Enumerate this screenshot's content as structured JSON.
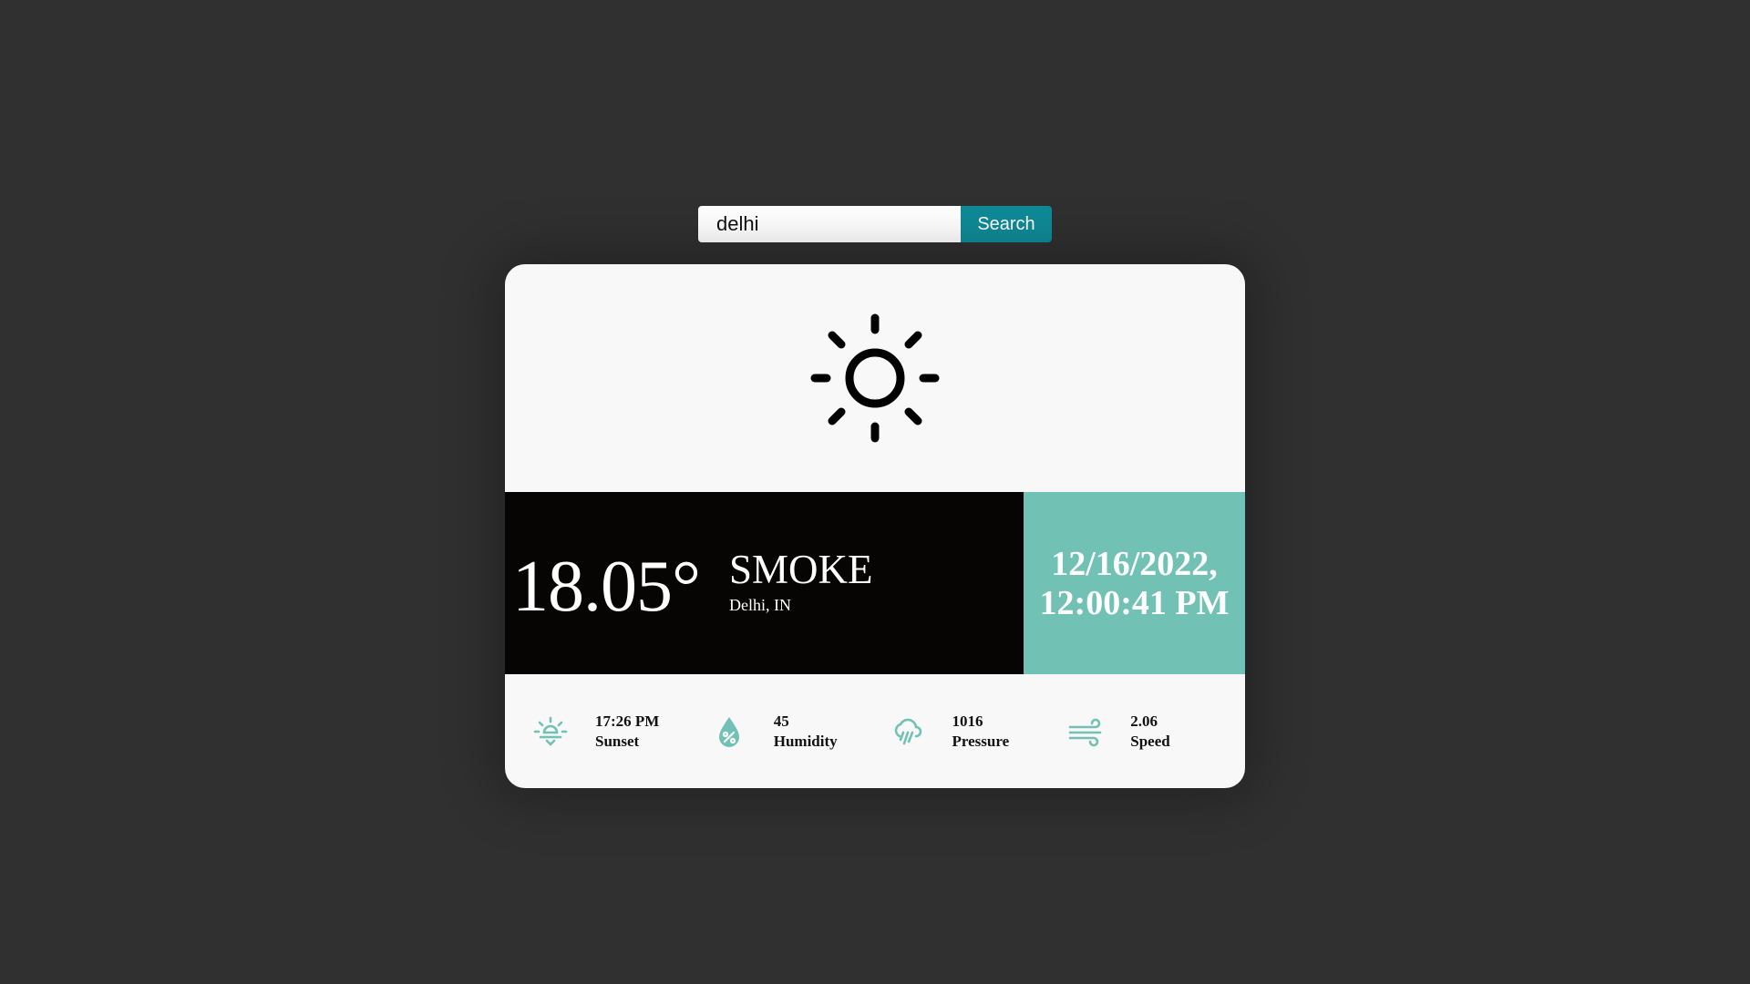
{
  "search": {
    "value": "delhi",
    "button_label": "Search"
  },
  "hero": {
    "icon": "sun-icon"
  },
  "current": {
    "temperature": "18.05°",
    "condition": "SMOKE",
    "location": "Delhi, IN",
    "date": "12/16/2022,",
    "time": "12:00:41 PM"
  },
  "stats": [
    {
      "icon": "sunset-icon",
      "value": "17:26 PM",
      "label": "Sunset"
    },
    {
      "icon": "humidity-icon",
      "value": "45",
      "label": "Humidity"
    },
    {
      "icon": "pressure-icon",
      "value": "1016",
      "label": "Pressure"
    },
    {
      "icon": "wind-icon",
      "value": "2.06",
      "label": "Speed"
    }
  ],
  "colors": {
    "background": "#303030",
    "card": "#f8f8f8",
    "accent": "#72c1b5",
    "button": "#0f8a97",
    "band": "#060503"
  }
}
